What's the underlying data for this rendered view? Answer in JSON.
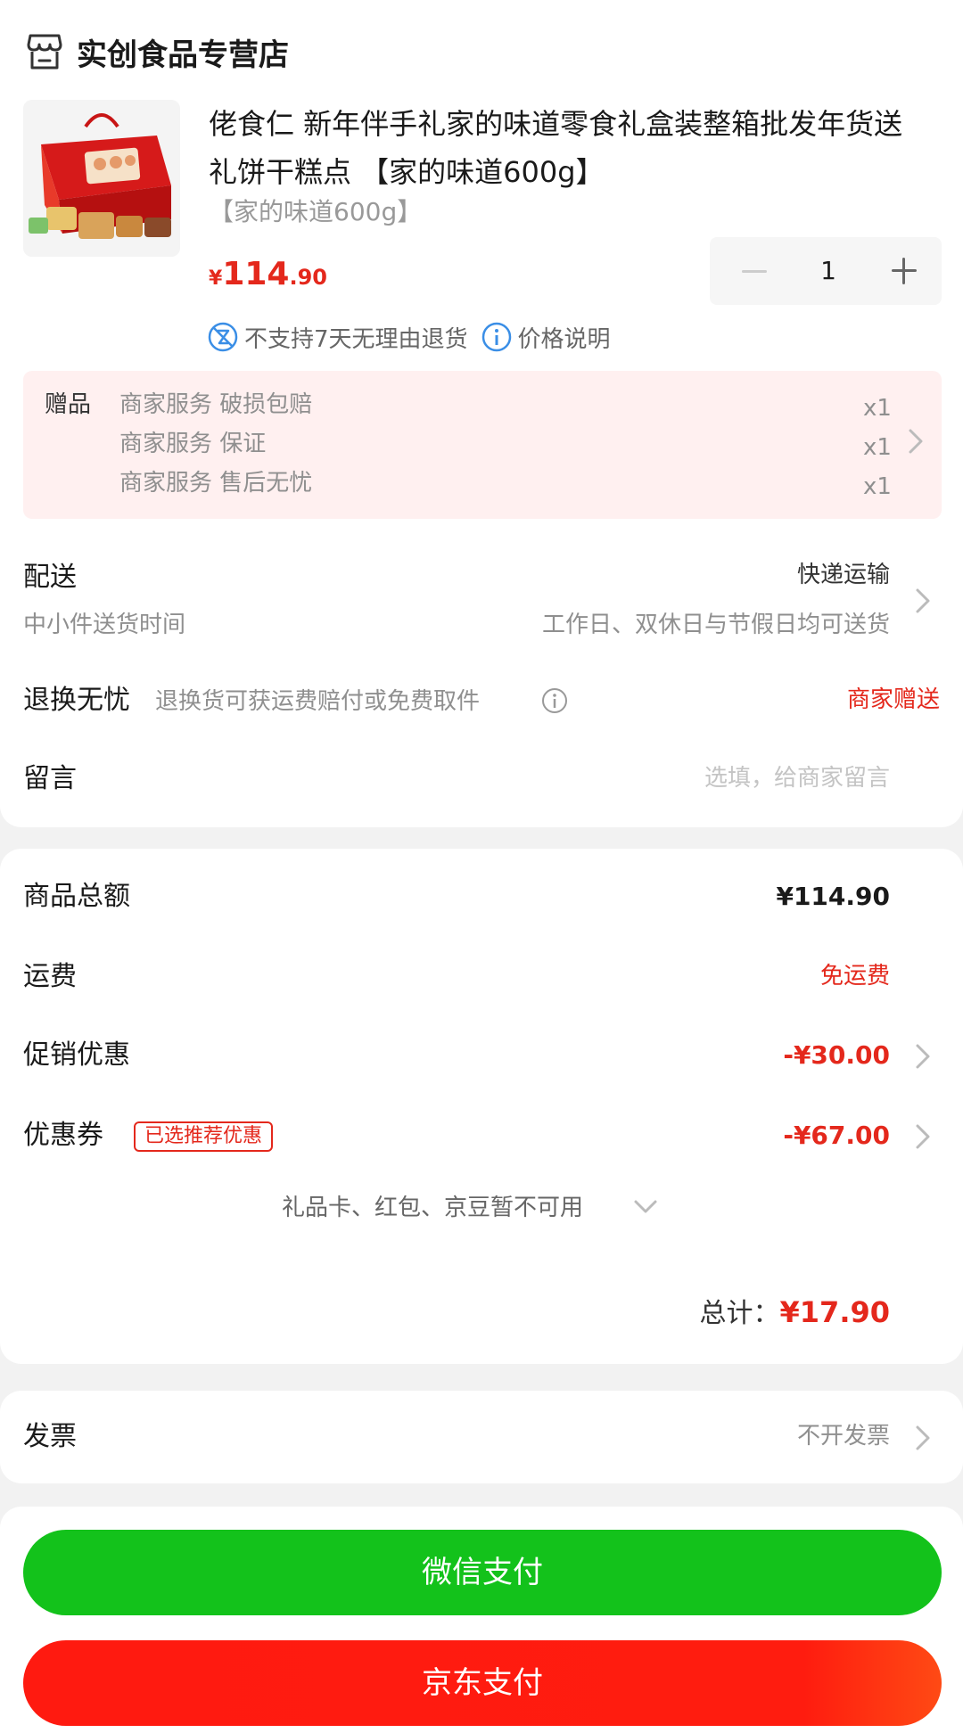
{
  "store": {
    "name": "实创食品专营店",
    "icon": "store-icon"
  },
  "product": {
    "title": "佬食仁 新年伴手礼家的味道零食礼盒装整箱批发年货送礼饼干糕点 【家的味道600g】",
    "spec": "【家的味道600g】",
    "price_currency": "¥",
    "price_int": "114",
    "price_dec": ".90",
    "quantity": "1",
    "policy_no_return": "不支持7天无理由退货",
    "policy_price_note": "价格说明",
    "image_icon": "gift-box-product-image"
  },
  "gifts": {
    "label": "赠品",
    "items": [
      {
        "name": "商家服务 破损包赔",
        "qty": "x1"
      },
      {
        "name": "商家服务 保证",
        "qty": "x1"
      },
      {
        "name": "商家服务 售后无忧",
        "qty": "x1"
      }
    ]
  },
  "delivery": {
    "label": "配送",
    "method": "快递运输",
    "sub_label": "中小件送货时间",
    "sub_value": "工作日、双休日与节假日均可送货"
  },
  "return_service": {
    "label": "退换无忧",
    "desc": "退换货可获运费赔付或免费取件",
    "value": "商家赠送"
  },
  "message": {
    "label": "留言",
    "placeholder": "选填，给商家留言"
  },
  "summary": {
    "goods_total_label": "商品总额",
    "goods_total_value": "¥114.90",
    "shipping_label": "运费",
    "shipping_value": "免运费",
    "promo_label": "促销优惠",
    "promo_value": "-¥30.00",
    "coupon_label": "优惠券",
    "coupon_badge": "已选推荐优惠",
    "coupon_value": "-¥67.00",
    "unavailable_note": "礼品卡、红包、京豆暂不可用",
    "total_label": "总计：",
    "total_value": "¥17.90"
  },
  "invoice": {
    "label": "发票",
    "value": "不开发票"
  },
  "payment": {
    "wechat_label": "微信支付",
    "jd_label": "京东支付"
  },
  "colors": {
    "accent_red": "#e4281c",
    "wechat_green": "#13c21b",
    "jd_red": "#ff1a10",
    "gift_bg": "#fff0f0",
    "policy_blue": "#3a8ee6"
  }
}
